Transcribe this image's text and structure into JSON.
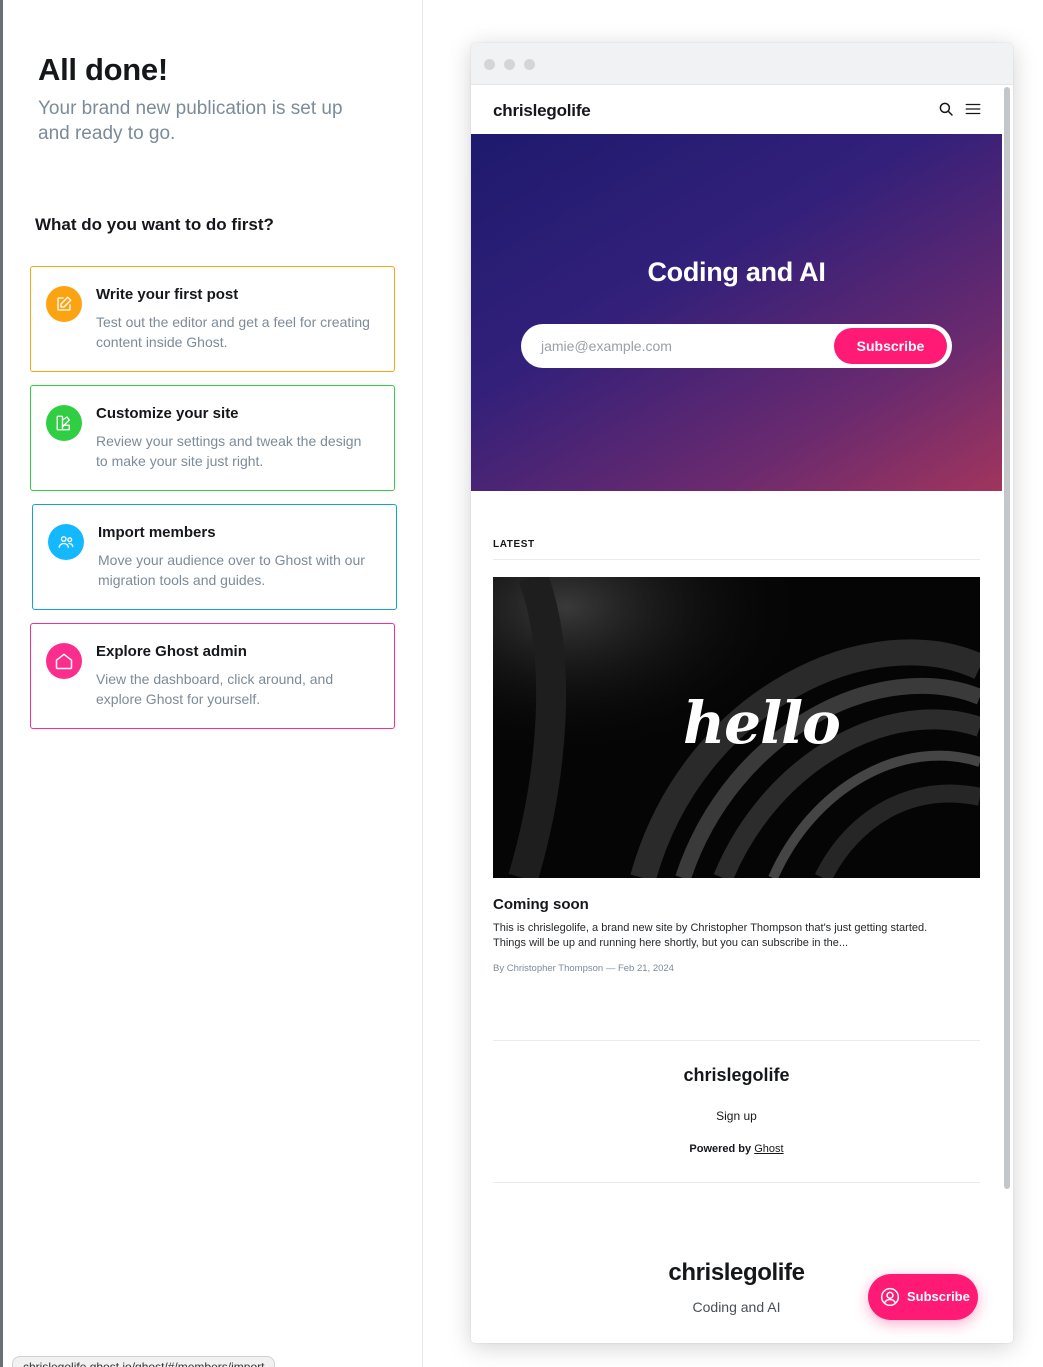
{
  "onboarding": {
    "title": "All done!",
    "subtitle": "Your brand new publication is set up and ready to go.",
    "question": "What do you want to do first?",
    "cards": [
      {
        "title": "Write your first post",
        "description": "Test out the editor and get a feel for creating content inside Ghost.",
        "color": "#fca311",
        "icon": "pencil-edit-icon"
      },
      {
        "title": "Customize your site",
        "description": "Review your settings and tweak the design to make your site just right.",
        "color": "#30cf43",
        "icon": "design-palette-icon"
      },
      {
        "title": "Import members",
        "description": "Move your audience over to Ghost with our migration tools and guides.",
        "color": "#14b8ff",
        "icon": "members-icon"
      },
      {
        "title": "Explore Ghost admin",
        "description": "View the dashboard, click around, and explore Ghost for yourself.",
        "color": "#fb2d8d",
        "icon": "house-icon"
      }
    ]
  },
  "status_url": "chrislegolife.ghost.io/ghost/#/members/import",
  "preview": {
    "site_name": "chrislegolife",
    "hero": {
      "title": "Coding and AI",
      "email_placeholder": "jamie@example.com",
      "subscribe_label": "Subscribe"
    },
    "latest_label": "LATEST",
    "featured_image_text": "hello",
    "post": {
      "title": "Coming soon",
      "excerpt": "This is chrislegolife, a brand new site by Christopher Thompson that's just getting started. Things will be up and running here shortly, but you can subscribe in the...",
      "meta": "By Christopher Thompson — Feb 21, 2024"
    },
    "footer": {
      "site_name": "chrislegolife",
      "signup_label": "Sign up",
      "powered_by": "Powered by",
      "powered_link": "Ghost"
    },
    "footer2": {
      "site_name": "chrislegolife",
      "tagline": "Coding and AI"
    },
    "portal_button_label": "Subscribe",
    "accent_color": "#ff1a75"
  }
}
